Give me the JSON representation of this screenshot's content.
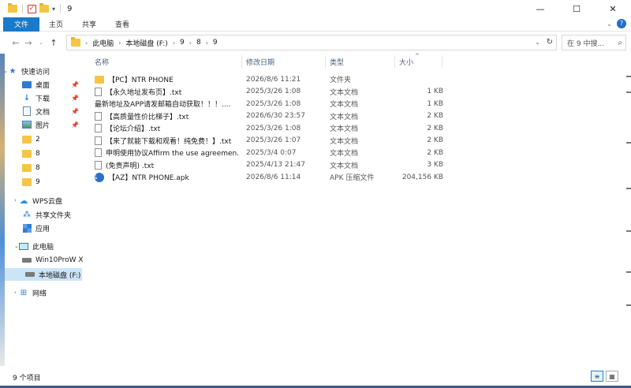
{
  "window": {
    "title": "9",
    "minimize": "—",
    "maximize": "☐",
    "close": "✕"
  },
  "ribbon": {
    "tabs": [
      "文件",
      "主页",
      "共享",
      "查看"
    ],
    "expand": "⌄",
    "help": "?"
  },
  "address": {
    "crumbs": [
      "此电脑",
      "本地磁盘 (F:)",
      "9",
      "8",
      "9"
    ],
    "separator": "›"
  },
  "search": {
    "placeholder": "在 9 中搜..."
  },
  "columns": {
    "name": "名称",
    "date": "修改日期",
    "type": "类型",
    "size": "大小"
  },
  "files": [
    {
      "name": "【PC】NTR PHONE",
      "date": "2026/8/6 11:21",
      "type": "文件夹",
      "size": "",
      "icon": "folder"
    },
    {
      "name": "【永久地址发布页】.txt",
      "date": "2025/3/26 1:08",
      "type": "文本文档",
      "size": "1 KB",
      "icon": "txt"
    },
    {
      "name": "最新地址及APP请发邮箱自动获取！！！....",
      "date": "2025/3/26 1:08",
      "type": "文本文档",
      "size": "1 KB",
      "icon": "none"
    },
    {
      "name": "【高质量性价比梯子】.txt",
      "date": "2026/6/30 23:57",
      "type": "文本文档",
      "size": "2 KB",
      "icon": "txt"
    },
    {
      "name": "【论坛介绍】.txt",
      "date": "2025/3/26 1:08",
      "type": "文本文档",
      "size": "2 KB",
      "icon": "txt"
    },
    {
      "name": "【来了就能下载和观看！纯免费！】.txt",
      "date": "2025/3/26 1:07",
      "type": "文本文档",
      "size": "2 KB",
      "icon": "txt"
    },
    {
      "name": "申明使用协议Affirm the use agreemen...",
      "date": "2025/3/4 0:07",
      "type": "文本文档",
      "size": "2 KB",
      "icon": "txt"
    },
    {
      "name": "(免责声明) .txt",
      "date": "2025/4/13 21:47",
      "type": "文本文档",
      "size": "3 KB",
      "icon": "txt"
    },
    {
      "name": "【AZ】NTR PHONE.apk",
      "date": "2026/8/6 11:14",
      "type": "APK 压缩文件",
      "size": "204,156 KB",
      "icon": "apk"
    }
  ],
  "navpane": {
    "quick_access": "快速访问",
    "desktop": "桌面",
    "downloads": "下载",
    "documents": "文档",
    "pictures": "图片",
    "folder_2": "2",
    "folder_8a": "8",
    "folder_8b": "8",
    "folder_9": "9",
    "wps": "WPS云盘",
    "shared": "共享文件夹",
    "apps": "应用",
    "this_pc": "此电脑",
    "drive_c": "Win10ProW X",
    "drive_f": "本地磁盘 (F:)",
    "network": "网络"
  },
  "status": {
    "count": "9 个项目"
  }
}
